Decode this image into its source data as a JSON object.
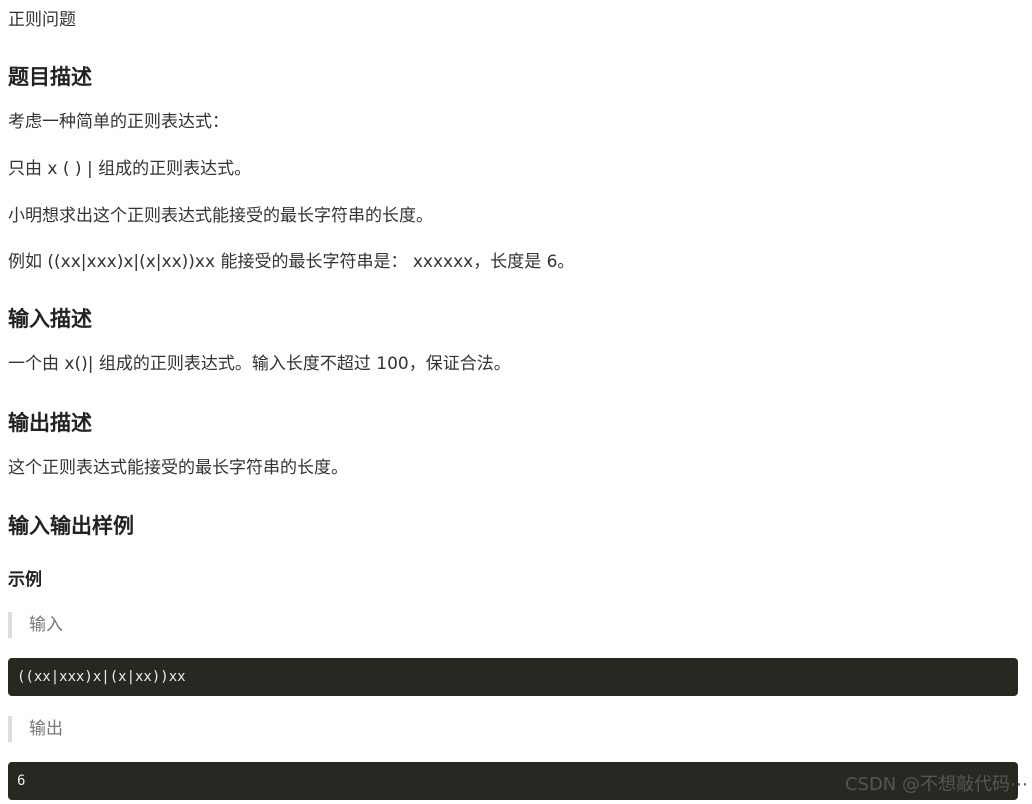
{
  "page": {
    "title": "正则问题"
  },
  "sections": {
    "description": {
      "heading": "题目描述",
      "paragraphs": [
        "考虑一种简单的正则表达式：",
        "只由 x ( ) | 组成的正则表达式。",
        "小明想求出这个正则表达式能接受的最长字符串的长度。",
        "例如 ((xx|xxx)x|(x|xx))xx 能接受的最长字符串是： xxxxxx，长度是 6。"
      ]
    },
    "input": {
      "heading": "输入描述",
      "text": "一个由 x()| 组成的正则表达式。输入长度不超过 100，保证合法。"
    },
    "output": {
      "heading": "输出描述",
      "text": "这个正则表达式能接受的最长字符串的长度。"
    },
    "samples": {
      "heading": "输入输出样例",
      "example_heading": "示例",
      "input_label": "输入",
      "input_code": "((xx|xxx)x|(x|xx))xx",
      "output_label": "输出",
      "output_code": "6"
    }
  },
  "watermark": "CSDN @不想敲代码⋯"
}
